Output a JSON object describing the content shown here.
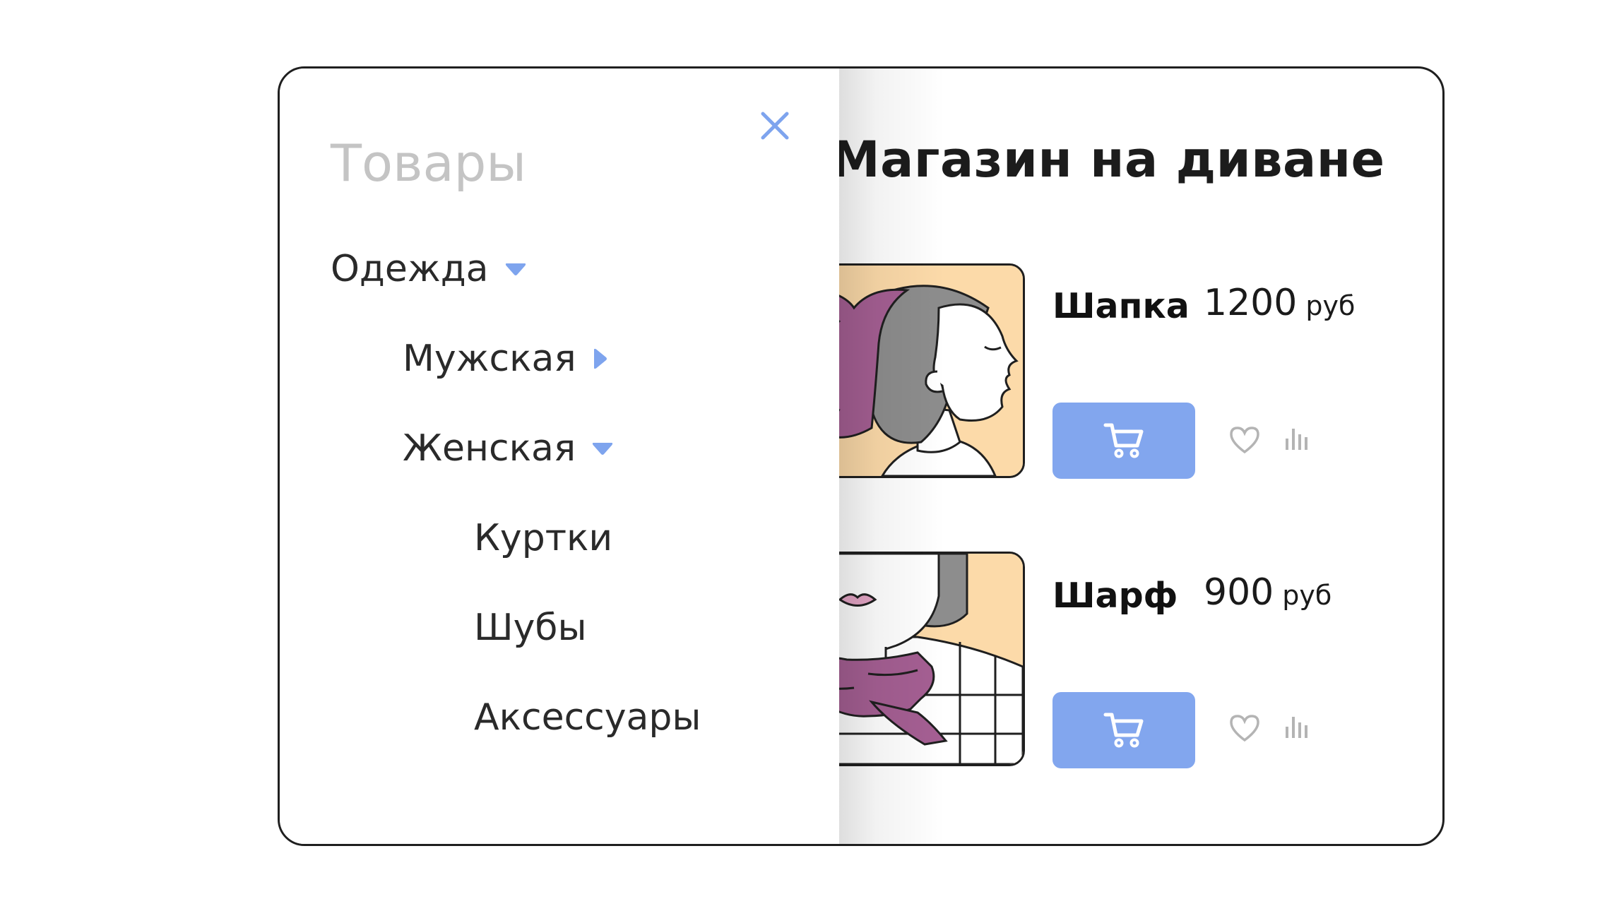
{
  "shop": {
    "title": "Магазин на диване"
  },
  "products": [
    {
      "name": "Шапка",
      "price": "1200",
      "currency": "руб",
      "image_icon": "woman-in-hat-illustration-icon",
      "cart_icon": "cart-icon",
      "favorite_icon": "heart-icon",
      "compare_icon": "compare-chart-icon"
    },
    {
      "name": "Шарф",
      "price": "900",
      "currency": "руб",
      "image_icon": "woman-with-scarf-illustration-icon",
      "cart_icon": "cart-icon",
      "favorite_icon": "heart-icon",
      "compare_icon": "compare-chart-icon"
    }
  ],
  "drawer": {
    "title": "Товары",
    "close_icon": "close-icon",
    "items": [
      {
        "label": "Одежда",
        "arrow": "triangle-down-icon"
      },
      {
        "label": "Мужская",
        "arrow": "triangle-right-icon"
      },
      {
        "label": "Женская",
        "arrow": "triangle-down-icon"
      },
      {
        "label": "Куртки"
      },
      {
        "label": "Шубы"
      },
      {
        "label": "Аксессуары"
      }
    ]
  },
  "colors": {
    "accent": "#82a6ee",
    "arrow": "#7ea4ee",
    "title_muted": "#c4c4c4",
    "image_bg": "#fcdaa9",
    "purple": "#a55f93",
    "gray_icon": "#b4b4b4"
  }
}
